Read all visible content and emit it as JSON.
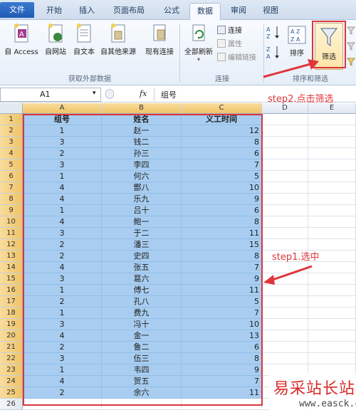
{
  "tabs": [
    {
      "label": "文件"
    },
    {
      "label": "开始"
    },
    {
      "label": "插入"
    },
    {
      "label": "页面布局"
    },
    {
      "label": "公式"
    },
    {
      "label": "数据"
    },
    {
      "label": "审阅"
    },
    {
      "label": "视图"
    }
  ],
  "active_tab": "数据",
  "ribbon": {
    "get_external": {
      "buttons": [
        "自 Access",
        "自网站",
        "自文本",
        "自其他来源",
        "现有连接"
      ],
      "group_label": "获取外部数据"
    },
    "connections": {
      "refresh_all": "全部刷新",
      "links": [
        "连接",
        "属性",
        "编辑链接"
      ],
      "group_label": "连接"
    },
    "sort_filter": {
      "sort": "排序",
      "filter": "筛选",
      "group_label": "排序和筛选"
    }
  },
  "formula_bar": {
    "name_box": "A1",
    "fx": "fx",
    "value": "组号"
  },
  "columns": [
    "A",
    "B",
    "C",
    "D",
    "E"
  ],
  "table": {
    "headers": [
      "组号",
      "姓名",
      "义工时间"
    ],
    "rows": [
      [
        "1",
        "赵一",
        "12"
      ],
      [
        "3",
        "钱二",
        "8"
      ],
      [
        "2",
        "孙三",
        "6"
      ],
      [
        "3",
        "李四",
        "7"
      ],
      [
        "1",
        "何六",
        "5"
      ],
      [
        "4",
        "酆八",
        "10"
      ],
      [
        "4",
        "乐九",
        "9"
      ],
      [
        "1",
        "吕十",
        "6"
      ],
      [
        "4",
        "鲍一",
        "8"
      ],
      [
        "3",
        "于二",
        "11"
      ],
      [
        "2",
        "潘三",
        "15"
      ],
      [
        "2",
        "史四",
        "8"
      ],
      [
        "4",
        "张五",
        "7"
      ],
      [
        "3",
        "葛六",
        "9"
      ],
      [
        "1",
        "傅七",
        "11"
      ],
      [
        "2",
        "孔八",
        "5"
      ],
      [
        "1",
        "费九",
        "7"
      ],
      [
        "3",
        "冯十",
        "10"
      ],
      [
        "4",
        "金一",
        "13"
      ],
      [
        "2",
        "鲁二",
        "6"
      ],
      [
        "3",
        "伍三",
        "8"
      ],
      [
        "1",
        "韦四",
        "9"
      ],
      [
        "4",
        "贺五",
        "7"
      ],
      [
        "2",
        "余六",
        "11"
      ]
    ]
  },
  "row_numbers": [
    "1",
    "2",
    "3",
    "4",
    "5",
    "6",
    "7",
    "8",
    "9",
    "10",
    "11",
    "12",
    "13",
    "14",
    "15",
    "16",
    "17",
    "18",
    "19",
    "20",
    "21",
    "22",
    "23",
    "24",
    "25",
    "26"
  ],
  "annotations": {
    "step1": "step1.选中",
    "step2": "step2.点击筛选"
  },
  "watermark": {
    "title": "易采站长站",
    "url": "www.easck.com"
  },
  "colors": {
    "annotation": "#d9363e",
    "selection": "#a8cdf0",
    "file_tab": "#2a68c4"
  }
}
